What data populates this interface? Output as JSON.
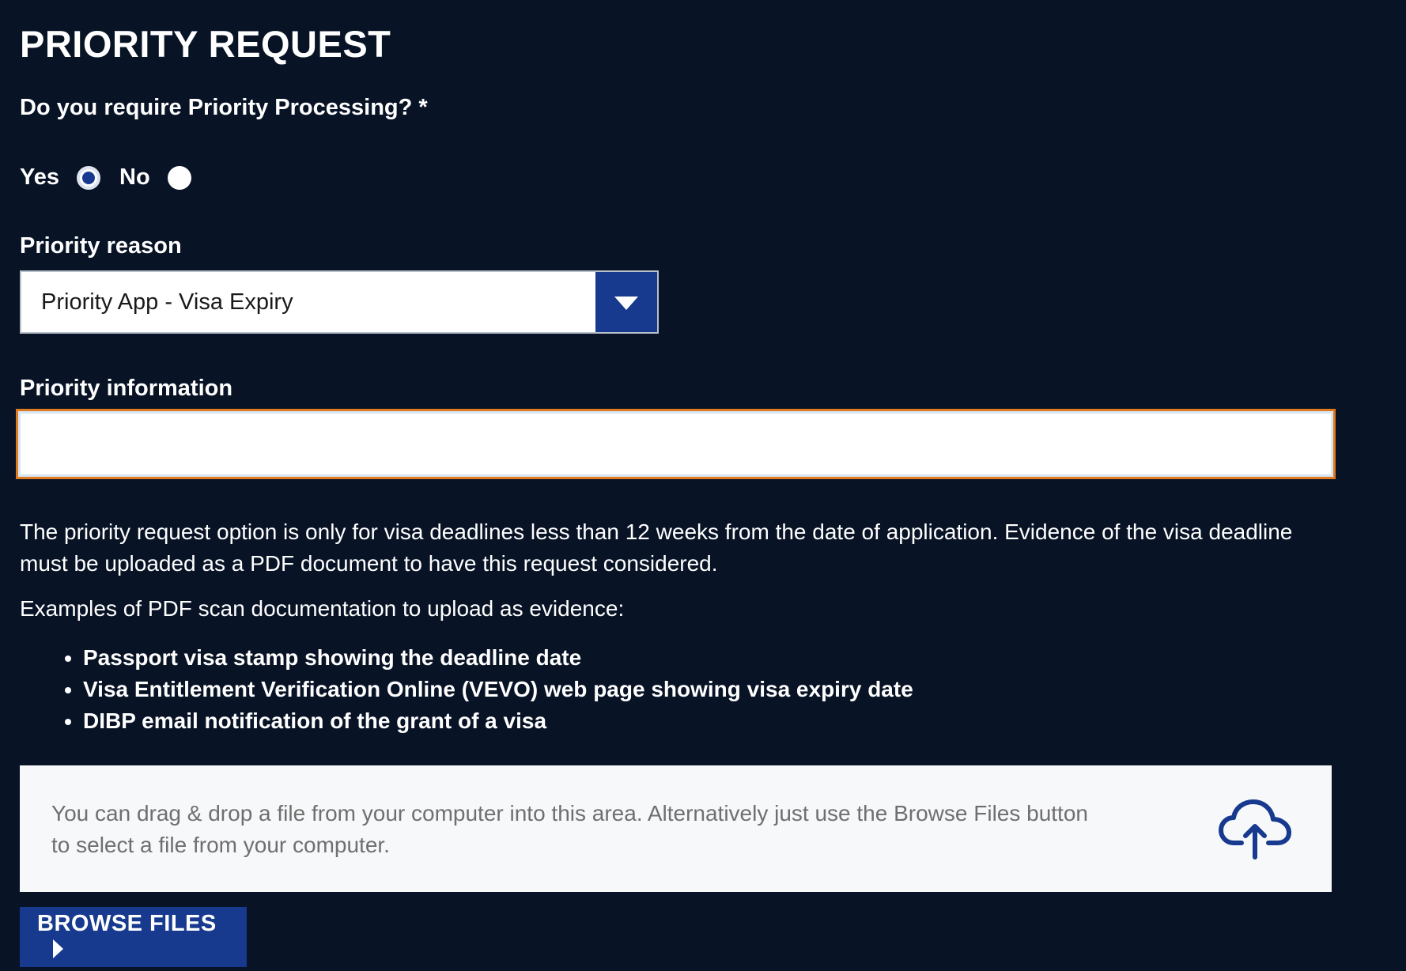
{
  "section": {
    "title": "PRIORITY REQUEST"
  },
  "priority_processing": {
    "question": "Do you require Priority Processing? *",
    "options": [
      {
        "label": "Yes",
        "selected": true
      },
      {
        "label": "No",
        "selected": false
      }
    ]
  },
  "priority_reason": {
    "label": "Priority reason",
    "selected_value": "Priority App - Visa Expiry"
  },
  "priority_information": {
    "label": "Priority information",
    "value": ""
  },
  "description": {
    "paragraph": "The priority request option is only for visa deadlines less than 12 weeks from the date of application. Evidence of the visa deadline must be uploaded as a PDF document to have this request considered.",
    "examples_heading": "Examples of PDF scan documentation to upload as evidence:",
    "examples": [
      "Passport visa stamp showing the deadline date",
      "Visa Entitlement Verification Online (VEVO) web page showing visa expiry date",
      "DIBP email notification of the grant of a visa"
    ]
  },
  "upload": {
    "dropzone_text": "You can drag & drop a file from your computer into this area. Alternatively just use the Browse Files button to select a file from your computer.",
    "icon": "cloud-upload-icon",
    "browse_label": "BROWSE FILES"
  },
  "colors": {
    "background": "#081326",
    "accent": "#173a8f",
    "focus_border": "#e07a1e",
    "dropzone_bg": "#f7f8fa"
  }
}
